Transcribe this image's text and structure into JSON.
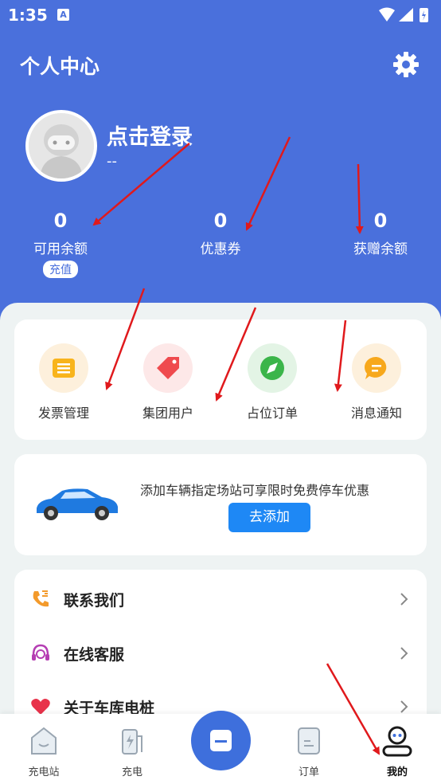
{
  "status": {
    "time": "1:35",
    "a_icon": "A"
  },
  "header": {
    "title": "个人中心",
    "settings_icon": "gear-icon"
  },
  "profile": {
    "login_text": "点击登录",
    "sub_text": "--"
  },
  "stats": [
    {
      "value": "0",
      "label": "可用余额",
      "badge": "充值"
    },
    {
      "value": "0",
      "label": "优惠券"
    },
    {
      "value": "0",
      "label": "获赠余额"
    }
  ],
  "functions": [
    {
      "label": "发票管理",
      "icon": "invoice-icon"
    },
    {
      "label": "集团用户",
      "icon": "tag-icon"
    },
    {
      "label": "占位订单",
      "icon": "compass-icon"
    },
    {
      "label": "消息通知",
      "icon": "chat-icon"
    }
  ],
  "promo": {
    "text": "添加车辆指定场站可享限时免费停车优惠",
    "button": "去添加"
  },
  "menu": [
    {
      "label": "联系我们",
      "icon": "phone-icon"
    },
    {
      "label": "在线客服",
      "icon": "headset-icon"
    },
    {
      "label": "关于车库电桩",
      "icon": "heart-icon"
    }
  ],
  "tabs": [
    {
      "label": "充电站"
    },
    {
      "label": "充电"
    },
    {
      "label": "订单"
    },
    {
      "label": "我的"
    }
  ],
  "colors": {
    "header": "#4a70dc",
    "accent": "#1e88f5",
    "arrow": "#e0191c"
  }
}
